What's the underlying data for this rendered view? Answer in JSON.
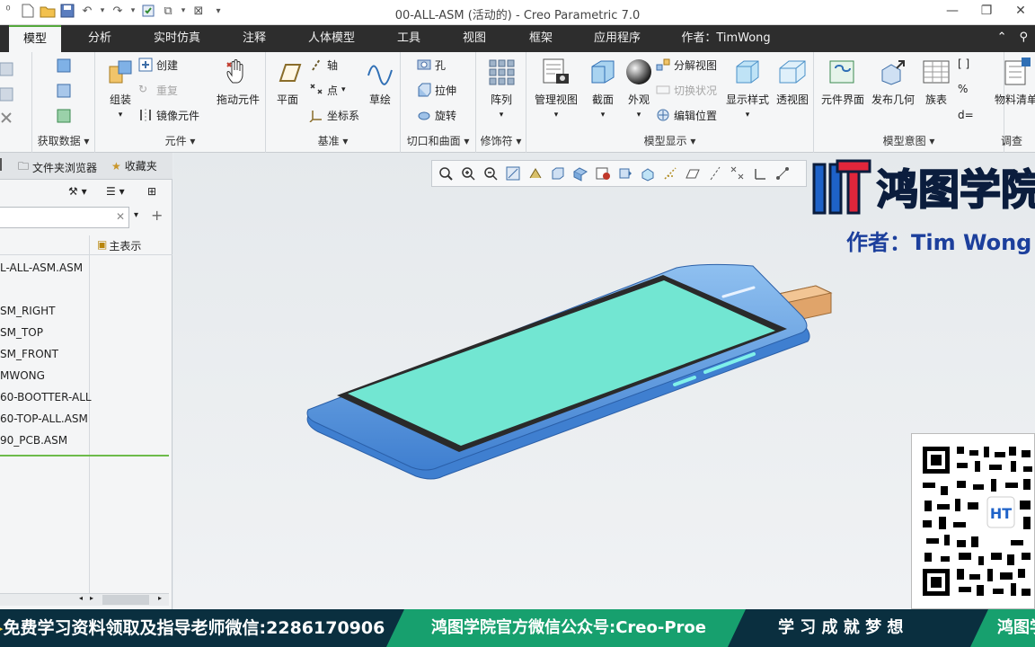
{
  "window": {
    "title": "00-ALL-ASM (活动的) - Creo Parametric 7.0"
  },
  "tabs": [
    {
      "label": "模型",
      "active": true
    },
    {
      "label": "分析"
    },
    {
      "label": "实时仿真"
    },
    {
      "label": "注释"
    },
    {
      "label": "人体模型"
    },
    {
      "label": "工具"
    },
    {
      "label": "视图"
    },
    {
      "label": "框架"
    },
    {
      "label": "应用程序"
    },
    {
      "label": "作者：TimWong"
    }
  ],
  "ribbon": {
    "get_data": {
      "label": "获取数据"
    },
    "components": {
      "label": "元件",
      "assemble": "组装",
      "create": "创建",
      "repeat": "重复",
      "mirror": "镜像元件",
      "drag": "拖动元件"
    },
    "datum": {
      "label": "基准",
      "plane": "平面",
      "axis": "轴",
      "point": "点",
      "csys": "坐标系",
      "sketch": "草绘"
    },
    "cut_surface": {
      "label": "切口和曲面",
      "hole": "孔",
      "extrude": "拉伸",
      "revolve": "旋转"
    },
    "modifiers": {
      "label": "修饰符",
      "pattern": "阵列"
    },
    "model_display": {
      "label": "模型显示",
      "manage_views": "管理视图",
      "section": "截面",
      "appearance": "外观",
      "exploded": "分解视图",
      "toggle_state": "切换状况",
      "edit_position": "编辑位置",
      "display_style": "显示样式",
      "perspective": "透视图"
    },
    "model_intent": {
      "label": "模型意图",
      "component_interface": "元件界面",
      "publish_geometry": "发布几何",
      "family_table": "族表",
      "d_equals": "d="
    },
    "investigate": {
      "label": "调查",
      "bom": "物料清单"
    }
  },
  "panel": {
    "tabs": [
      {
        "label": "文件夹浏览器"
      },
      {
        "label": "收藏夹"
      }
    ],
    "search_value": "",
    "column_header": "主表示",
    "tree_items": [
      "L-ALL-ASM.ASM",
      "",
      "SM_RIGHT",
      "SM_TOP",
      "SM_FRONT",
      "MWONG",
      "60-BOOTTER-ALL",
      "60-TOP-ALL.ASM",
      "90_PCB.ASM"
    ]
  },
  "overlay": {
    "logo_text": "鸿图学院",
    "author": "作者：Tim Wong",
    "qr_badge": "HT"
  },
  "banner": {
    "seg1": "免费学习资料领取及指导老师微信:2286170906",
    "seg2": "鸿图学院官方微信公众号:Creo-Proe",
    "seg3": "学 习 成 就 梦 想",
    "seg4": "鸿图学"
  },
  "colors": {
    "tab_bar": "#2d2d2d",
    "active_tab_border": "#54a83c",
    "phone_body": "#6ea8e6",
    "phone_screen": "#72e6d2",
    "phone_usb": "#e0a46a",
    "banner": "#0a2f3f",
    "banner_accent": "#17a06e",
    "author_text": "#1c3f9c"
  },
  "icons": [
    "new-file-icon",
    "open-icon",
    "save-icon",
    "undo-icon",
    "redo-icon",
    "regenerate-icon",
    "windows-icon",
    "close-window-icon",
    "zoom-fit-icon",
    "zoom-in-icon",
    "zoom-out-icon",
    "repaint-icon"
  ]
}
